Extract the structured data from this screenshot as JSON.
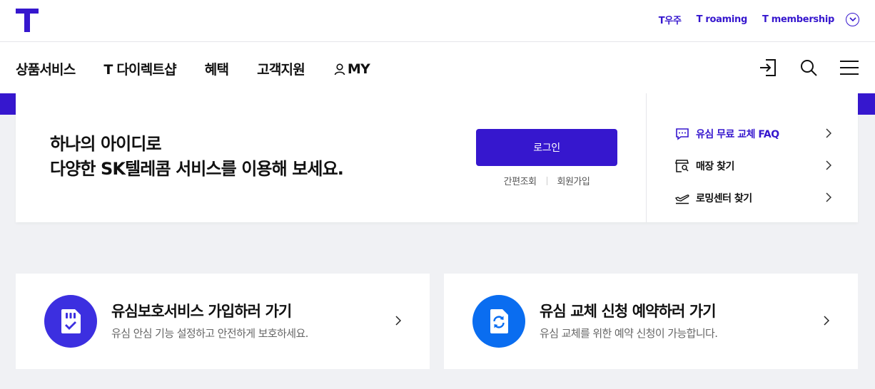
{
  "header": {
    "logo_label": "T",
    "util_links": [
      "T우주",
      "T roaming",
      "T membership"
    ]
  },
  "gnb": {
    "menu": [
      "상품서비스",
      "T 다이렉트샵",
      "혜택",
      "고객지원",
      "MY"
    ],
    "icons": [
      "login-icon",
      "search-icon",
      "hamburger-menu-icon"
    ]
  },
  "login": {
    "headline_line1": "하나의 아이디로",
    "headline_line2": "다양한 SK텔레콤 서비스를 이용해 보세요.",
    "button_label": "로그인",
    "sub_links": [
      "간편조회",
      "회원가입"
    ]
  },
  "quick_links": [
    {
      "label": "유심 무료 교체 FAQ",
      "icon": "faq-icon"
    },
    {
      "label": "매장 찾기",
      "icon": "store-search-icon"
    },
    {
      "label": "로밍센터 찾기",
      "icon": "airplane-icon"
    }
  ],
  "services": [
    {
      "title": "유심보호서비스 가입하러 가기",
      "description": "유심 안심 기능 설정하고 안전하게 보호하세요.",
      "icon": "usim-check-icon",
      "color": "#3c2fe0"
    },
    {
      "title": "유심 교체 신청 예약하러 가기",
      "description": "유심 교체를 위한 예약 신청이 가능합니다.",
      "icon": "usim-refresh-icon",
      "color": "#0a6df0"
    }
  ],
  "colors": {
    "brand_purple": "#3617ce",
    "background_gray": "#f0f1f4"
  }
}
